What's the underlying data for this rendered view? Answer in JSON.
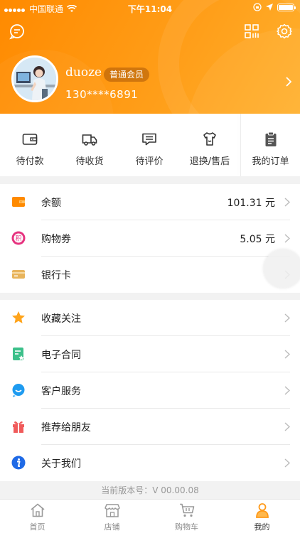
{
  "status_bar": {
    "carrier": "中国联通",
    "time": "下午11:04"
  },
  "profile": {
    "username": "duoze",
    "member_level": "普通会员",
    "phone": "130****6891"
  },
  "orders": [
    {
      "label": "待付款",
      "icon": "wallet-icon"
    },
    {
      "label": "待收货",
      "icon": "truck-icon"
    },
    {
      "label": "待评价",
      "icon": "comment-icon"
    },
    {
      "label": "退换/售后",
      "icon": "return-icon"
    },
    {
      "label": "我的订单",
      "icon": "clipboard-icon"
    }
  ],
  "finance": [
    {
      "label": "余额",
      "value": "101.31 元",
      "icon": "wallet-icon",
      "color": "#ff8a00"
    },
    {
      "label": "购物券",
      "value": "5.05 元",
      "icon": "coupon-icon",
      "color": "#e6337f"
    },
    {
      "label": "银行卡",
      "value": "",
      "icon": "bank-card-icon",
      "color": "#e8b45c"
    }
  ],
  "services": [
    {
      "label": "收藏关注",
      "icon": "star-icon",
      "color": "#ffa41b"
    },
    {
      "label": "电子合同",
      "icon": "contract-icon",
      "color": "#3cc08a"
    },
    {
      "label": "客户服务",
      "icon": "customer-service-icon",
      "color": "#1e9bf0"
    },
    {
      "label": "推荐给朋友",
      "icon": "gift-icon",
      "color": "#f05a5a"
    },
    {
      "label": "关于我们",
      "icon": "info-icon",
      "color": "#1f6ae6"
    }
  ],
  "version_text": "当前版本号：V 00.00.08",
  "tabs": [
    {
      "label": "首页",
      "icon": "home-icon"
    },
    {
      "label": "店铺",
      "icon": "store-icon"
    },
    {
      "label": "购物车",
      "icon": "cart-icon"
    },
    {
      "label": "我的",
      "icon": "person-icon",
      "active": true
    }
  ]
}
